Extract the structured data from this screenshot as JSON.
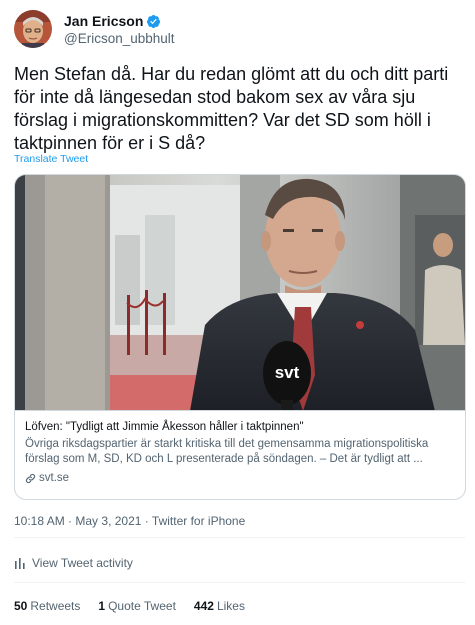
{
  "user": {
    "display_name": "Jan Ericson",
    "handle": "@Ericson_ubbhult",
    "verified": true
  },
  "tweet": {
    "text": "Men Stefan då. Har du redan glömt att du och ditt parti för inte då längesedan stod bakom sex av våra sju förslag i migrationskommitten? Var det SD som höll i taktpinnen för er i S då?",
    "translate_label": "Translate Tweet"
  },
  "card": {
    "media_logo_text": "svt",
    "title": "Löfven: \"Tydligt att Jimmie Åkesson håller i taktpinnen\"",
    "description": "Övriga riksdagspartier är starkt kritiska till det gemensamma migrationspolitiska förslag som M, SD, KD och L presenterade på söndagen. – Det är tydligt att ...",
    "domain": "svt.se"
  },
  "meta": {
    "time": "10:18 AM",
    "separator": "·",
    "date": "May 3, 2021",
    "source": "Twitter for iPhone"
  },
  "activity": {
    "label": "View Tweet activity"
  },
  "stats": {
    "retweets": {
      "count": "50",
      "label": "Retweets"
    },
    "quotes": {
      "count": "1",
      "label": "Quote Tweet"
    },
    "likes": {
      "count": "442",
      "label": "Likes"
    }
  },
  "colors": {
    "accent": "#1d9bf0",
    "text": "#0f1419",
    "secondary": "#536471",
    "border": "#cfd9de"
  },
  "icons": {
    "verified": "verified-badge-icon",
    "link": "link-icon",
    "activity": "bar-chart-icon"
  }
}
